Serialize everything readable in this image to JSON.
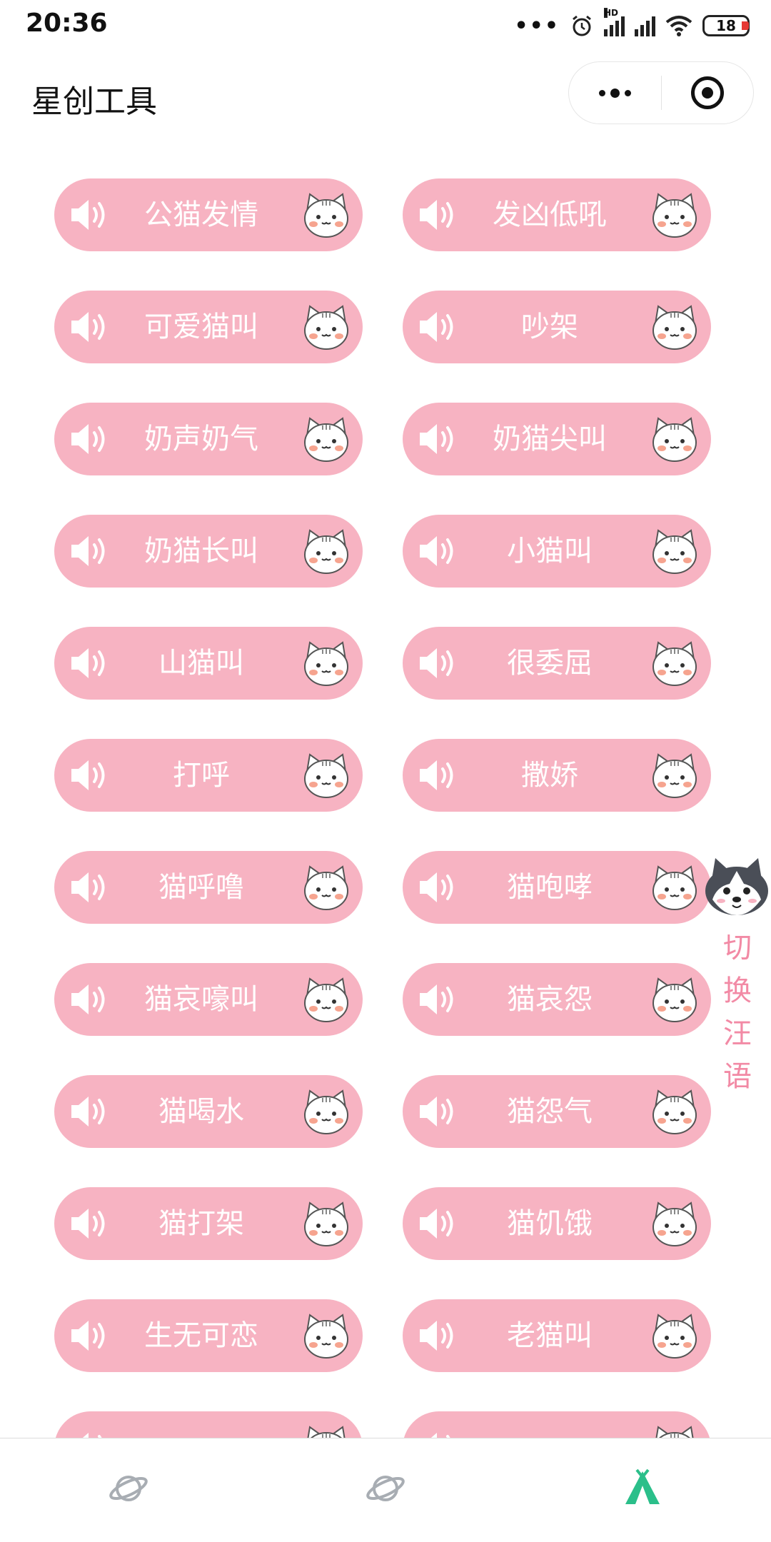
{
  "status_bar": {
    "time": "20:36",
    "battery": "18",
    "icons": [
      "more-dots-icon",
      "alarm-icon",
      "hd-signal-icon",
      "signal-icon",
      "wifi-icon",
      "battery-icon"
    ]
  },
  "nav": {
    "title": "星创工具",
    "more_icon": "more-dots-icon",
    "close_icon": "target-icon"
  },
  "buttons": [
    "公猫发情",
    "发凶低吼",
    "可爱猫叫",
    "吵架",
    "奶声奶气",
    "奶猫尖叫",
    "奶猫长叫",
    "小猫叫",
    "山猫叫",
    "很委屈",
    "打呼",
    "撒娇",
    "猫呼噜",
    "猫咆哮",
    "猫哀嚎叫",
    "猫哀怨",
    "猫喝水",
    "猫怨气",
    "猫打架",
    "猫饥饿",
    "生无可恋",
    "老猫叫",
    "",
    ""
  ],
  "dog_switch": {
    "chars": [
      "切",
      "换",
      "汪",
      "语"
    ],
    "icon": "husky-icon"
  },
  "tabbar": {
    "items": [
      {
        "icon": "planet-icon",
        "active": false
      },
      {
        "icon": "planet-icon",
        "active": false
      },
      {
        "icon": "tent-icon",
        "active": true
      }
    ],
    "active_color": "#2bbf8a",
    "inactive_color": "#a8adb3"
  },
  "colors": {
    "button_bg": "#f7b3c2",
    "button_text": "#ffffff",
    "switch_text": "#f28aa5"
  }
}
